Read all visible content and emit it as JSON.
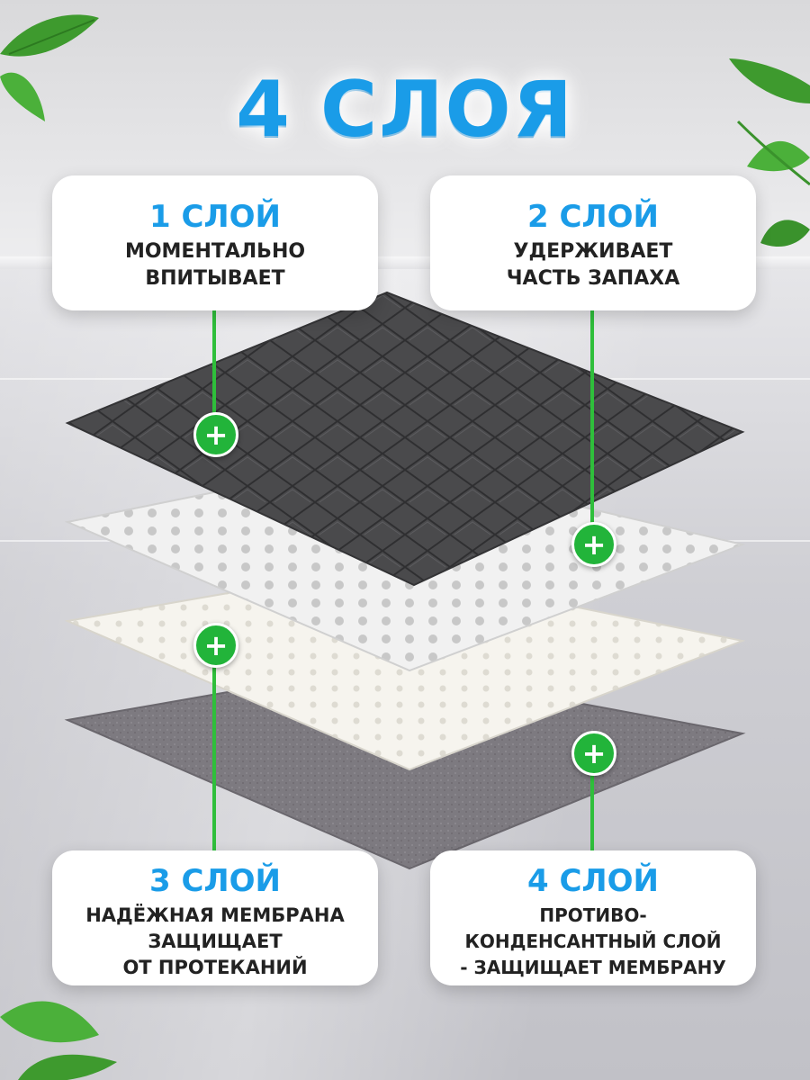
{
  "title": "4 СЛОЯ",
  "cards": [
    {
      "head": "1 СЛОЙ",
      "body": "МОМЕНТАЛЬНО\nВПИТЫВАЕТ"
    },
    {
      "head": "2 СЛОЙ",
      "body": "УДЕРЖИВАЕТ\nЧАСТЬ ЗАПАХА"
    },
    {
      "head": "3 СЛОЙ",
      "body": "НАДЁЖНАЯ МЕМБРАНА\nЗАЩИЩАЕТ\nОТ ПРОТЕКАНИЙ"
    },
    {
      "head": "4 СЛОЙ",
      "body": "ПРОТИВО-\nКОНДЕНСАНТНЫЙ СЛОЙ\n- ЗАЩИЩАЕТ МЕМБРАНУ"
    }
  ],
  "plus_symbol": "+",
  "colors": {
    "accent_blue": "#1a9ce8",
    "plus_green": "#22b43a",
    "layer1": "#4a4a4c",
    "layer2": "#f1f1f1",
    "layer3": "#f6f4ee",
    "layer4": "#7d7a80"
  }
}
